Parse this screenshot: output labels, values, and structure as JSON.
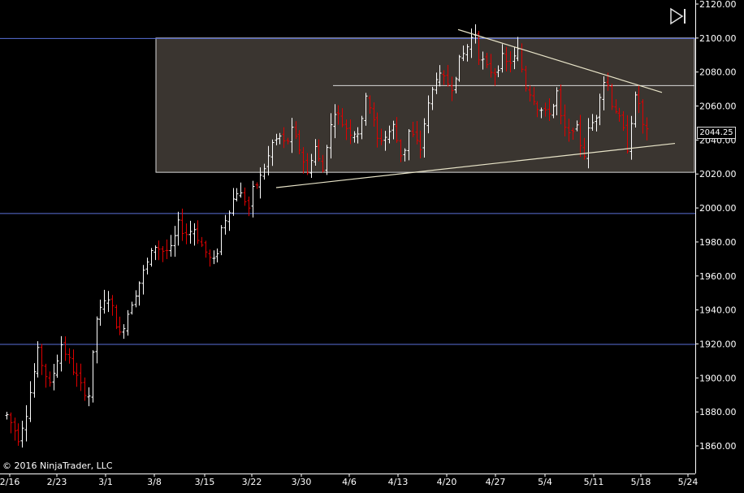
{
  "copyright": "© 2016 NinjaTrader, LLC",
  "current_price_label": "2044.25",
  "colors": {
    "background": "#000000",
    "up_bar": "#ffffff",
    "down_bar": "#e00000",
    "horizontal_line": "#5a70d8",
    "rectangle_fill": "#3a3530",
    "rectangle_border": "#d8d8d8",
    "trendline": "#e8e4c8"
  },
  "chart_data": {
    "type": "ohlc",
    "y_ticks": [
      "2120.00",
      "2100.00",
      "2080.00",
      "2060.00",
      "2040.00",
      "2020.00",
      "2000.00",
      "1980.00",
      "1960.00",
      "1940.00",
      "1920.00",
      "1900.00",
      "1880.00",
      "1860.00"
    ],
    "ylim": [
      1853,
      2122
    ],
    "x_ticks": [
      "2/16",
      "2/23",
      "3/1",
      "3/8",
      "3/15",
      "3/22",
      "3/30",
      "4/6",
      "4/13",
      "4/20",
      "4/27",
      "5/4",
      "5/11",
      "5/18",
      "5/24"
    ],
    "horizontal_lines": [
      2100,
      1997,
      1920
    ],
    "rectangle": {
      "x_start": "3/8",
      "x_end": "5/24",
      "y_low": 2021,
      "y_high": 2100
    },
    "inner_level": 2072,
    "trendlines": [
      {
        "x1": "4/21",
        "y1": 2105,
        "x2": "5/21",
        "y2": 2068
      },
      {
        "x1": "3/24",
        "y1": 2012,
        "x2": "5/22",
        "y2": 2038
      }
    ],
    "last_price": 2044.25,
    "price_waypoints": [
      [
        0,
        1878
      ],
      [
        3,
        1865
      ],
      [
        5,
        1880
      ],
      [
        8,
        1915
      ],
      [
        11,
        1895
      ],
      [
        14,
        1920
      ],
      [
        17,
        1905
      ],
      [
        19,
        1895
      ],
      [
        21,
        1890
      ],
      [
        23,
        1935
      ],
      [
        26,
        1948
      ],
      [
        29,
        1925
      ],
      [
        32,
        1945
      ],
      [
        35,
        1962
      ],
      [
        38,
        1978
      ],
      [
        40,
        1975
      ],
      [
        42,
        1975
      ],
      [
        44,
        1990
      ],
      [
        46,
        1985
      ],
      [
        48,
        1988
      ],
      [
        50,
        1978
      ],
      [
        52,
        1970
      ],
      [
        53,
        1968
      ],
      [
        54,
        1975
      ],
      [
        55,
        1988
      ],
      [
        57,
        2000
      ],
      [
        59,
        2010
      ],
      [
        61,
        2005
      ],
      [
        62,
        2000
      ],
      [
        63,
        2010
      ],
      [
        65,
        2018
      ],
      [
        67,
        2030
      ],
      [
        68,
        2038
      ],
      [
        69,
        2040
      ],
      [
        70,
        2042
      ],
      [
        71,
        2038
      ],
      [
        72,
        2040
      ],
      [
        73,
        2045
      ],
      [
        75,
        2035
      ],
      [
        76,
        2028
      ],
      [
        77,
        2020
      ],
      [
        78,
        2030
      ],
      [
        79,
        2036
      ],
      [
        80,
        2028
      ],
      [
        81,
        2022
      ],
      [
        82,
        2038
      ],
      [
        84,
        2058
      ],
      [
        86,
        2050
      ],
      [
        88,
        2045
      ],
      [
        90,
        2045
      ],
      [
        91,
        2050
      ],
      [
        92,
        2068
      ],
      [
        93,
        2060
      ],
      [
        95,
        2040
      ],
      [
        97,
        2042
      ],
      [
        99,
        2048
      ],
      [
        101,
        2032
      ],
      [
        102,
        2035
      ],
      [
        103,
        2045
      ],
      [
        104,
        2042
      ],
      [
        105,
        2038
      ],
      [
        106,
        2035
      ],
      [
        107,
        2050
      ],
      [
        108,
        2060
      ],
      [
        110,
        2078
      ],
      [
        112,
        2075
      ],
      [
        114,
        2072
      ],
      [
        116,
        2086
      ],
      [
        118,
        2095
      ],
      [
        119,
        2100
      ],
      [
        120,
        2103
      ],
      [
        121,
        2090
      ],
      [
        123,
        2082
      ],
      [
        125,
        2080
      ],
      [
        127,
        2088
      ],
      [
        128,
        2085
      ],
      [
        130,
        2088
      ],
      [
        131,
        2092
      ],
      [
        133,
        2072
      ],
      [
        135,
        2065
      ],
      [
        136,
        2060
      ],
      [
        138,
        2055
      ],
      [
        140,
        2060
      ],
      [
        141,
        2068
      ],
      [
        142,
        2052
      ],
      [
        143,
        2046
      ],
      [
        144,
        2042
      ],
      [
        145,
        2048
      ],
      [
        146,
        2046
      ],
      [
        147,
        2038
      ],
      [
        148,
        2032
      ],
      [
        149,
        2045
      ],
      [
        150,
        2050
      ],
      [
        151,
        2055
      ],
      [
        152,
        2068
      ],
      [
        153,
        2075
      ],
      [
        154,
        2072
      ],
      [
        155,
        2062
      ],
      [
        156,
        2058
      ],
      [
        158,
        2045
      ],
      [
        159,
        2036
      ],
      [
        160,
        2052
      ],
      [
        161,
        2064
      ],
      [
        162,
        2062
      ],
      [
        163,
        2048
      ],
      [
        164,
        2044
      ]
    ]
  }
}
